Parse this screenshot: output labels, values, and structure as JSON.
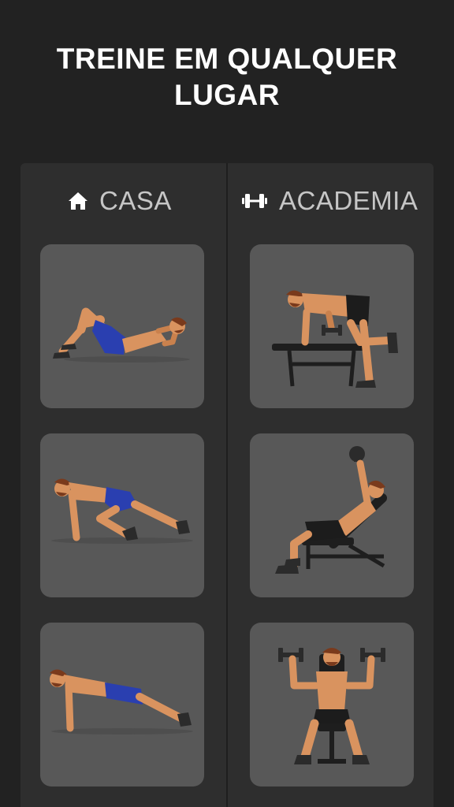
{
  "headline": {
    "line1": "TREINE EM QUALQUER",
    "line2": "LUGAR"
  },
  "columns": [
    {
      "label": "CASA",
      "icon": "home-icon",
      "exercises": [
        {
          "icon": "crunch-exercise-illustration"
        },
        {
          "icon": "mountain-climber-exercise-illustration"
        },
        {
          "icon": "plank-exercise-illustration"
        }
      ]
    },
    {
      "label": "ACADEMIA",
      "icon": "dumbbell-icon",
      "exercises": [
        {
          "icon": "dumbbell-row-exercise-illustration"
        },
        {
          "icon": "incline-dumbbell-press-exercise-illustration"
        },
        {
          "icon": "dumbbell-shoulder-press-exercise-illustration"
        }
      ]
    }
  ],
  "colors": {
    "background": "#222222",
    "panel": "#2e2e2e",
    "card": "#585858",
    "header_text": "#c6c6c6",
    "skin": "#d9935f",
    "shorts_home": "#2a3fb0",
    "shorts_gym": "#1c1c1c"
  }
}
